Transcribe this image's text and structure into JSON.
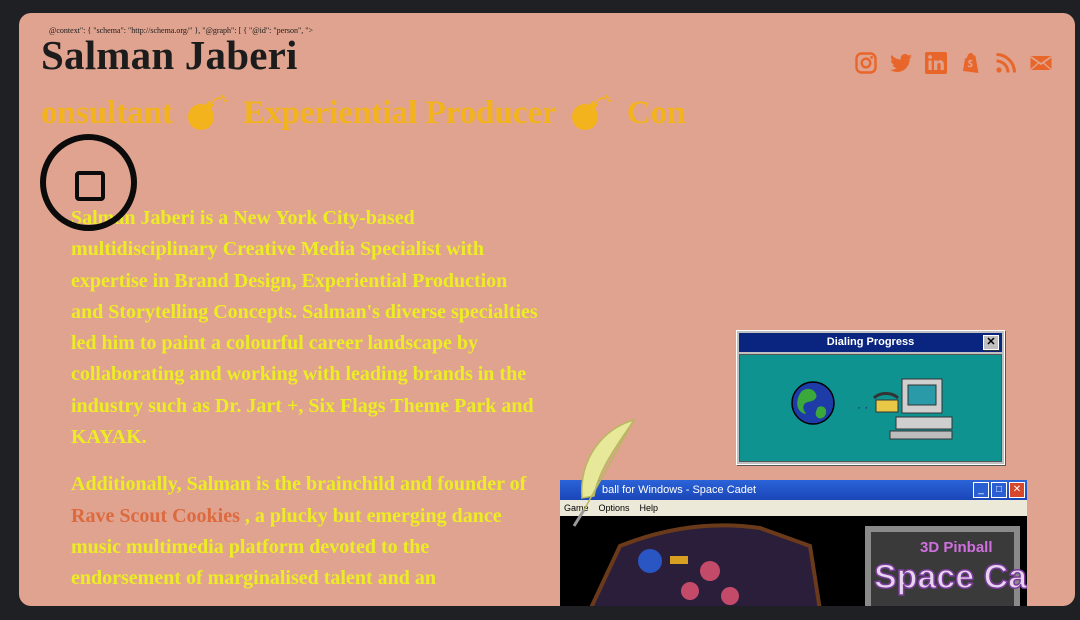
{
  "schema_snippet": "@context\": { \"schema\": \"http://schema.org/\" }, \"@graph\": [ { \"@id\": \"person\", \">",
  "site_title": "Salman Jaberi",
  "social_links": [
    {
      "name": "instagram-icon"
    },
    {
      "name": "twitter-icon"
    },
    {
      "name": "linkedin-icon"
    },
    {
      "name": "shopify-icon"
    },
    {
      "name": "rss-icon"
    },
    {
      "name": "email-icon"
    }
  ],
  "ticker": {
    "segment_1": "onsultant",
    "segment_2": "Experiential Producer",
    "segment_3": "Con",
    "separator_icon": "bomb-icon"
  },
  "menu_button_icon": "square-icon",
  "bio": {
    "paragraph_1": "Salman Jaberi is a New York City-based multidisciplinary Creative Media Specialist with expertise in Brand Design, Experiential Production and Storytelling Concepts. Salman's diverse specialties led him to paint a colourful career landscape by collaborating and working with leading brands in the industry such as Dr. Jart +, Six Flags Theme Park and KAYAK.",
    "paragraph_2_before": "Additionally, Salman is the brainchild and founder of ",
    "paragraph_2_link": "Rave Scout Cookies",
    "paragraph_2_after": " , a plucky but emerging dance music multimedia platform devoted to the endorsement of marginalised talent and an"
  },
  "dialing_window": {
    "title": "Dialing Progress",
    "close_label": "✕",
    "dots": "· ·"
  },
  "pinball_window": {
    "title": "ball for Windows - Space Cadet",
    "menus": [
      "Game",
      "Options",
      "Help"
    ],
    "logo_small": "3D Pinball",
    "logo_big": "Space Cadet",
    "controls": [
      "_",
      "□",
      "✕"
    ]
  },
  "colors": {
    "page_background": "#1f2023",
    "card_background": "#e0a38f",
    "title_text": "#1c1c1c",
    "accent_orange": "#e8662a",
    "ticker_text": "#f3b31c",
    "bio_text": "#eded24",
    "link_text": "#dc6a3e"
  }
}
